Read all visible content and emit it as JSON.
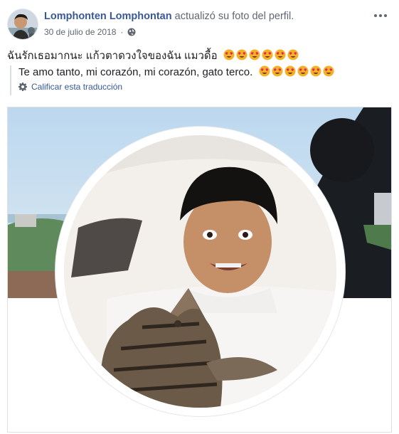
{
  "post": {
    "author": "Lomphonten Lomphontan",
    "action": "actualizó su foto del perfil.",
    "date": "30 de julio de 2018",
    "privacy_icon": "globe-icon",
    "more_icon": "more-options-icon",
    "original_text": "ฉันรักเธอมากนะ แก้วตาดวงใจของฉัน แมวดื้อ",
    "original_emoji_count": 6,
    "translation_text": "Te amo tanto, mi corazón, mi corazón, gato terco.",
    "translation_emoji_count": 6,
    "rate_translation_label": "Calificar esta traducción",
    "rate_icon": "gear-icon",
    "emoji_icon": "heart-eyes-emoji-icon"
  },
  "colors": {
    "link": "#385898",
    "secondary_text": "#606770",
    "border": "#dddfe2"
  }
}
